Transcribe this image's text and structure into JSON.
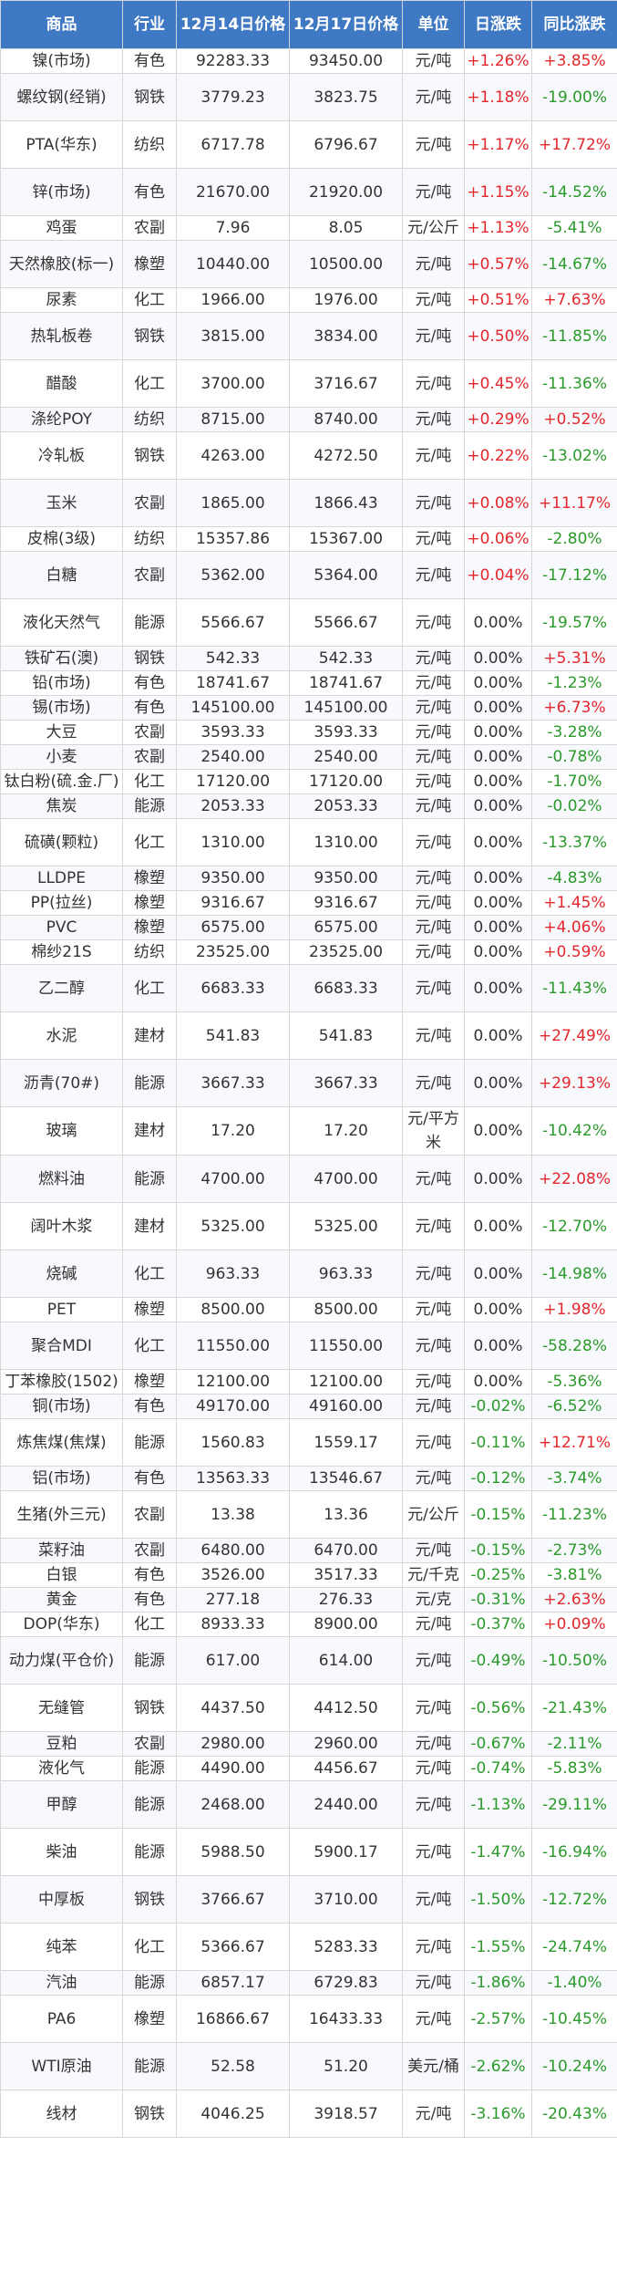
{
  "headers": [
    "商品",
    "行业",
    "12月14日价格",
    "12月17日价格",
    "单位",
    "日涨跌",
    "同比涨跌"
  ],
  "colors": {
    "header_bg": "#3f79c4",
    "positive": "#e5262c",
    "negative": "#2a9a2a"
  },
  "rows": [
    {
      "name": "镍(市场)",
      "industry": "有色",
      "p1": "92283.33",
      "p2": "93450.00",
      "unit": "元/吨",
      "day": "+1.26%",
      "yoy": "+3.85%"
    },
    {
      "name": "螺纹钢(经销)",
      "industry": "钢铁",
      "p1": "3779.23",
      "p2": "3823.75",
      "unit": "元/吨",
      "day": "+1.18%",
      "yoy": "-19.00%"
    },
    {
      "name": "PTA(华东)",
      "industry": "纺织",
      "p1": "6717.78",
      "p2": "6796.67",
      "unit": "元/吨",
      "day": "+1.17%",
      "yoy": "+17.72%"
    },
    {
      "name": "锌(市场)",
      "industry": "有色",
      "p1": "21670.00",
      "p2": "21920.00",
      "unit": "元/吨",
      "day": "+1.15%",
      "yoy": "-14.52%"
    },
    {
      "name": "鸡蛋",
      "industry": "农副",
      "p1": "7.96",
      "p2": "8.05",
      "unit": "元/公斤",
      "day": "+1.13%",
      "yoy": "-5.41%"
    },
    {
      "name": "天然橡胶(标一)",
      "industry": "橡塑",
      "p1": "10440.00",
      "p2": "10500.00",
      "unit": "元/吨",
      "day": "+0.57%",
      "yoy": "-14.67%"
    },
    {
      "name": "尿素",
      "industry": "化工",
      "p1": "1966.00",
      "p2": "1976.00",
      "unit": "元/吨",
      "day": "+0.51%",
      "yoy": "+7.63%"
    },
    {
      "name": "热轧板卷",
      "industry": "钢铁",
      "p1": "3815.00",
      "p2": "3834.00",
      "unit": "元/吨",
      "day": "+0.50%",
      "yoy": "-11.85%"
    },
    {
      "name": "醋酸",
      "industry": "化工",
      "p1": "3700.00",
      "p2": "3716.67",
      "unit": "元/吨",
      "day": "+0.45%",
      "yoy": "-11.36%"
    },
    {
      "name": "涤纶POY",
      "industry": "纺织",
      "p1": "8715.00",
      "p2": "8740.00",
      "unit": "元/吨",
      "day": "+0.29%",
      "yoy": "+0.52%"
    },
    {
      "name": "冷轧板",
      "industry": "钢铁",
      "p1": "4263.00",
      "p2": "4272.50",
      "unit": "元/吨",
      "day": "+0.22%",
      "yoy": "-13.02%"
    },
    {
      "name": "玉米",
      "industry": "农副",
      "p1": "1865.00",
      "p2": "1866.43",
      "unit": "元/吨",
      "day": "+0.08%",
      "yoy": "+11.17%"
    },
    {
      "name": "皮棉(3级)",
      "industry": "纺织",
      "p1": "15357.86",
      "p2": "15367.00",
      "unit": "元/吨",
      "day": "+0.06%",
      "yoy": "-2.80%"
    },
    {
      "name": "白糖",
      "industry": "农副",
      "p1": "5362.00",
      "p2": "5364.00",
      "unit": "元/吨",
      "day": "+0.04%",
      "yoy": "-17.12%"
    },
    {
      "name": "液化天然气",
      "industry": "能源",
      "p1": "5566.67",
      "p2": "5566.67",
      "unit": "元/吨",
      "day": "0.00%",
      "yoy": "-19.57%"
    },
    {
      "name": "铁矿石(澳)",
      "industry": "钢铁",
      "p1": "542.33",
      "p2": "542.33",
      "unit": "元/吨",
      "day": "0.00%",
      "yoy": "+5.31%"
    },
    {
      "name": "铅(市场)",
      "industry": "有色",
      "p1": "18741.67",
      "p2": "18741.67",
      "unit": "元/吨",
      "day": "0.00%",
      "yoy": "-1.23%"
    },
    {
      "name": "锡(市场)",
      "industry": "有色",
      "p1": "145100.00",
      "p2": "145100.00",
      "unit": "元/吨",
      "day": "0.00%",
      "yoy": "+6.73%"
    },
    {
      "name": "大豆",
      "industry": "农副",
      "p1": "3593.33",
      "p2": "3593.33",
      "unit": "元/吨",
      "day": "0.00%",
      "yoy": "-3.28%"
    },
    {
      "name": "小麦",
      "industry": "农副",
      "p1": "2540.00",
      "p2": "2540.00",
      "unit": "元/吨",
      "day": "0.00%",
      "yoy": "-0.78%"
    },
    {
      "name": "钛白粉(硫.金.厂)",
      "industry": "化工",
      "p1": "17120.00",
      "p2": "17120.00",
      "unit": "元/吨",
      "day": "0.00%",
      "yoy": "-1.70%"
    },
    {
      "name": "焦炭",
      "industry": "能源",
      "p1": "2053.33",
      "p2": "2053.33",
      "unit": "元/吨",
      "day": "0.00%",
      "yoy": "-0.02%"
    },
    {
      "name": "硫磺(颗粒)",
      "industry": "化工",
      "p1": "1310.00",
      "p2": "1310.00",
      "unit": "元/吨",
      "day": "0.00%",
      "yoy": "-13.37%"
    },
    {
      "name": "LLDPE",
      "industry": "橡塑",
      "p1": "9350.00",
      "p2": "9350.00",
      "unit": "元/吨",
      "day": "0.00%",
      "yoy": "-4.83%"
    },
    {
      "name": "PP(拉丝)",
      "industry": "橡塑",
      "p1": "9316.67",
      "p2": "9316.67",
      "unit": "元/吨",
      "day": "0.00%",
      "yoy": "+1.45%"
    },
    {
      "name": "PVC",
      "industry": "橡塑",
      "p1": "6575.00",
      "p2": "6575.00",
      "unit": "元/吨",
      "day": "0.00%",
      "yoy": "+4.06%"
    },
    {
      "name": "棉纱21S",
      "industry": "纺织",
      "p1": "23525.00",
      "p2": "23525.00",
      "unit": "元/吨",
      "day": "0.00%",
      "yoy": "+0.59%"
    },
    {
      "name": "乙二醇",
      "industry": "化工",
      "p1": "6683.33",
      "p2": "6683.33",
      "unit": "元/吨",
      "day": "0.00%",
      "yoy": "-11.43%"
    },
    {
      "name": "水泥",
      "industry": "建材",
      "p1": "541.83",
      "p2": "541.83",
      "unit": "元/吨",
      "day": "0.00%",
      "yoy": "+27.49%"
    },
    {
      "name": "沥青(70#)",
      "industry": "能源",
      "p1": "3667.33",
      "p2": "3667.33",
      "unit": "元/吨",
      "day": "0.00%",
      "yoy": "+29.13%"
    },
    {
      "name": "玻璃",
      "industry": "建材",
      "p1": "17.20",
      "p2": "17.20",
      "unit": "元/平方米",
      "day": "0.00%",
      "yoy": "-10.42%"
    },
    {
      "name": "燃料油",
      "industry": "能源",
      "p1": "4700.00",
      "p2": "4700.00",
      "unit": "元/吨",
      "day": "0.00%",
      "yoy": "+22.08%"
    },
    {
      "name": "阔叶木浆",
      "industry": "建材",
      "p1": "5325.00",
      "p2": "5325.00",
      "unit": "元/吨",
      "day": "0.00%",
      "yoy": "-12.70%"
    },
    {
      "name": "烧碱",
      "industry": "化工",
      "p1": "963.33",
      "p2": "963.33",
      "unit": "元/吨",
      "day": "0.00%",
      "yoy": "-14.98%"
    },
    {
      "name": "PET",
      "industry": "橡塑",
      "p1": "8500.00",
      "p2": "8500.00",
      "unit": "元/吨",
      "day": "0.00%",
      "yoy": "+1.98%"
    },
    {
      "name": "聚合MDI",
      "industry": "化工",
      "p1": "11550.00",
      "p2": "11550.00",
      "unit": "元/吨",
      "day": "0.00%",
      "yoy": "-58.28%"
    },
    {
      "name": "丁苯橡胶(1502)",
      "industry": "橡塑",
      "p1": "12100.00",
      "p2": "12100.00",
      "unit": "元/吨",
      "day": "0.00%",
      "yoy": "-5.36%"
    },
    {
      "name": "铜(市场)",
      "industry": "有色",
      "p1": "49170.00",
      "p2": "49160.00",
      "unit": "元/吨",
      "day": "-0.02%",
      "yoy": "-6.52%"
    },
    {
      "name": "炼焦煤(焦煤)",
      "industry": "能源",
      "p1": "1560.83",
      "p2": "1559.17",
      "unit": "元/吨",
      "day": "-0.11%",
      "yoy": "+12.71%"
    },
    {
      "name": "铝(市场)",
      "industry": "有色",
      "p1": "13563.33",
      "p2": "13546.67",
      "unit": "元/吨",
      "day": "-0.12%",
      "yoy": "-3.74%"
    },
    {
      "name": "生猪(外三元)",
      "industry": "农副",
      "p1": "13.38",
      "p2": "13.36",
      "unit": "元/公斤",
      "day": "-0.15%",
      "yoy": "-11.23%"
    },
    {
      "name": "菜籽油",
      "industry": "农副",
      "p1": "6480.00",
      "p2": "6470.00",
      "unit": "元/吨",
      "day": "-0.15%",
      "yoy": "-2.73%"
    },
    {
      "name": "白银",
      "industry": "有色",
      "p1": "3526.00",
      "p2": "3517.33",
      "unit": "元/千克",
      "day": "-0.25%",
      "yoy": "-3.81%"
    },
    {
      "name": "黄金",
      "industry": "有色",
      "p1": "277.18",
      "p2": "276.33",
      "unit": "元/克",
      "day": "-0.31%",
      "yoy": "+2.63%"
    },
    {
      "name": "DOP(华东)",
      "industry": "化工",
      "p1": "8933.33",
      "p2": "8900.00",
      "unit": "元/吨",
      "day": "-0.37%",
      "yoy": "+0.09%"
    },
    {
      "name": "动力煤(平仓价)",
      "industry": "能源",
      "p1": "617.00",
      "p2": "614.00",
      "unit": "元/吨",
      "day": "-0.49%",
      "yoy": "-10.50%"
    },
    {
      "name": "无缝管",
      "industry": "钢铁",
      "p1": "4437.50",
      "p2": "4412.50",
      "unit": "元/吨",
      "day": "-0.56%",
      "yoy": "-21.43%"
    },
    {
      "name": "豆粕",
      "industry": "农副",
      "p1": "2980.00",
      "p2": "2960.00",
      "unit": "元/吨",
      "day": "-0.67%",
      "yoy": "-2.11%"
    },
    {
      "name": "液化气",
      "industry": "能源",
      "p1": "4490.00",
      "p2": "4456.67",
      "unit": "元/吨",
      "day": "-0.74%",
      "yoy": "-5.83%"
    },
    {
      "name": "甲醇",
      "industry": "能源",
      "p1": "2468.00",
      "p2": "2440.00",
      "unit": "元/吨",
      "day": "-1.13%",
      "yoy": "-29.11%"
    },
    {
      "name": "柴油",
      "industry": "能源",
      "p1": "5988.50",
      "p2": "5900.17",
      "unit": "元/吨",
      "day": "-1.47%",
      "yoy": "-16.94%"
    },
    {
      "name": "中厚板",
      "industry": "钢铁",
      "p1": "3766.67",
      "p2": "3710.00",
      "unit": "元/吨",
      "day": "-1.50%",
      "yoy": "-12.72%"
    },
    {
      "name": "纯苯",
      "industry": "化工",
      "p1": "5366.67",
      "p2": "5283.33",
      "unit": "元/吨",
      "day": "-1.55%",
      "yoy": "-24.74%"
    },
    {
      "name": "汽油",
      "industry": "能源",
      "p1": "6857.17",
      "p2": "6729.83",
      "unit": "元/吨",
      "day": "-1.86%",
      "yoy": "-1.40%"
    },
    {
      "name": "PA6",
      "industry": "橡塑",
      "p1": "16866.67",
      "p2": "16433.33",
      "unit": "元/吨",
      "day": "-2.57%",
      "yoy": "-10.45%"
    },
    {
      "name": "WTI原油",
      "industry": "能源",
      "p1": "52.58",
      "p2": "51.20",
      "unit": "美元/桶",
      "day": "-2.62%",
      "yoy": "-10.24%"
    },
    {
      "name": "线材",
      "industry": "钢铁",
      "p1": "4046.25",
      "p2": "3918.57",
      "unit": "元/吨",
      "day": "-3.16%",
      "yoy": "-20.43%"
    }
  ]
}
